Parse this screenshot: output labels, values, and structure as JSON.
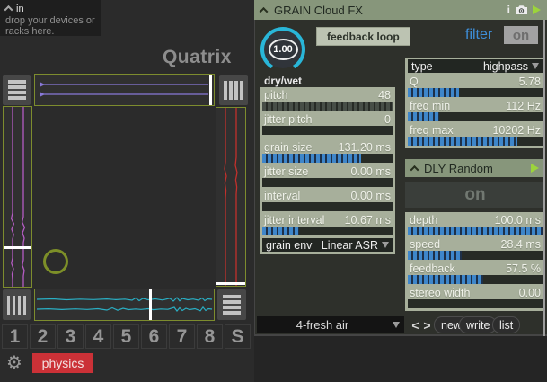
{
  "tooltip": {
    "label": "in",
    "body": "drop your devices or racks here."
  },
  "quatrix": {
    "title": "Quatrix",
    "scenes": [
      "1",
      "2",
      "3",
      "4",
      "5",
      "6",
      "7",
      "8",
      "S"
    ],
    "physics_label": "physics",
    "colors": {
      "top_wave": "#8878d8",
      "left_wave": "#b55cc4",
      "right_wave": "#c2302c",
      "bottom_wave": "#2aafc4",
      "strip_border": "#7d8c2e",
      "cursor_ring": "#7d8f28",
      "physics": "#cb3137"
    }
  },
  "grain": {
    "title": "GRAIN Cloud FX",
    "drywet_value": "1.00",
    "drywet_label": "dry/wet",
    "feedback_loop_label": "feedback loop",
    "filter_label": "filter",
    "filter_on_label": "on",
    "sliders": [
      {
        "label": "pitch",
        "value": "48",
        "fill_css": "width:100%"
      },
      {
        "label": "jitter pitch",
        "value": "0",
        "fill_css": "width:0%"
      },
      {
        "label": "grain size",
        "value": "131.20 ms",
        "fill_css": "width:76%"
      },
      {
        "label": "jitter size",
        "value": "0.00 ms",
        "fill_css": "width:0%"
      },
      {
        "label": "interval",
        "value": "0.00 ms",
        "fill_css": "width:0%"
      },
      {
        "label": "jitter interval",
        "value": "10.67 ms",
        "fill_css": "width:28%"
      }
    ],
    "grain_env_label": "grain env",
    "grain_env_value": "Linear ASR",
    "filter": {
      "type_label": "type",
      "type_value": "highpass",
      "sliders": [
        {
          "label": "Q",
          "value": "5.78",
          "fill_css": "width:38%"
        },
        {
          "label": "freq min",
          "value": "112 Hz",
          "fill_css": "width:23%"
        },
        {
          "label": "freq max",
          "value": "10202 Hz",
          "fill_css": "width:81%"
        }
      ]
    },
    "dly": {
      "title": "DLY Random",
      "on_label": "on",
      "sliders": [
        {
          "label": "depth",
          "value": "100.0 ms",
          "fill_css": "width:100%"
        },
        {
          "label": "speed",
          "value": "28.4 ms",
          "fill_css": "width:40%"
        },
        {
          "label": "feedback",
          "value": "57.5 %",
          "fill_css": "width:56%"
        },
        {
          "label": "stereo width",
          "value": "0.00",
          "fill_css": "width:0%"
        }
      ]
    },
    "presets": {
      "current": "4-fresh air",
      "prev": "<",
      "next": ">",
      "new_label": "new",
      "write_label": "write",
      "list_label": "list"
    },
    "colors": {
      "accent": "#29b6d8",
      "header": "#87967b",
      "block": "#a7af9b",
      "slider_fill": "#3e86ca"
    }
  }
}
